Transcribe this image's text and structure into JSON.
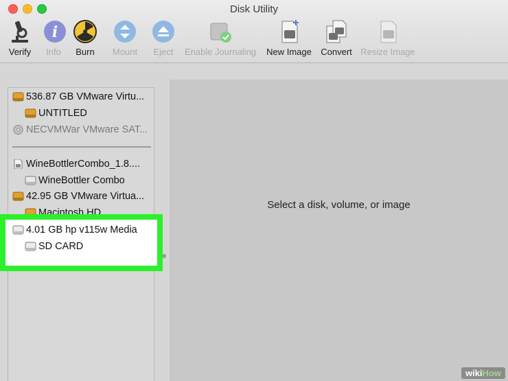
{
  "window": {
    "title": "Disk Utility"
  },
  "colors": {
    "highlight": "#2cf02c",
    "close": "#fc5f57",
    "minimize": "#fdbc2e",
    "zoom": "#28c840"
  },
  "toolbar": [
    {
      "label": "Verify",
      "icon": "microscope-icon",
      "enabled": true
    },
    {
      "label": "Info",
      "icon": "info-icon",
      "enabled": false
    },
    {
      "label": "Burn",
      "icon": "burn-radiation-icon",
      "enabled": true
    },
    {
      "label": "Mount",
      "icon": "mount-icon",
      "enabled": false
    },
    {
      "label": "Eject",
      "icon": "eject-icon",
      "enabled": false
    },
    {
      "label": "Enable Journaling",
      "icon": "journaling-icon",
      "enabled": false
    },
    {
      "label": "New Image",
      "icon": "new-image-icon",
      "enabled": true
    },
    {
      "label": "Convert",
      "icon": "convert-icon",
      "enabled": true
    },
    {
      "label": "Resize Image",
      "icon": "resize-image-icon",
      "enabled": false
    }
  ],
  "sidebar": {
    "items": [
      {
        "label": "536.87 GB VMware Virtu...",
        "icon": "hard-disk-icon"
      },
      {
        "label": "UNTITLED",
        "icon": "volume-icon"
      },
      {
        "label": "NECVMWar VMware SAT...",
        "icon": "optical-disc-icon"
      },
      {
        "label": "WineBottlerCombo_1.8....",
        "icon": "disk-image-icon"
      },
      {
        "label": "WineBottler Combo",
        "icon": "volume-icon"
      },
      {
        "label": "42.95 GB VMware Virtua...",
        "icon": "hard-disk-icon"
      },
      {
        "label": "Macintosh HD",
        "icon": "volume-icon"
      },
      {
        "label": "4.01 GB hp v115w Media",
        "icon": "usb-drive-icon"
      },
      {
        "label": "SD CARD",
        "icon": "volume-icon"
      }
    ]
  },
  "main": {
    "message": "Select a disk, volume, or image"
  },
  "watermark": {
    "wiki": "wiki",
    "how": "How"
  }
}
